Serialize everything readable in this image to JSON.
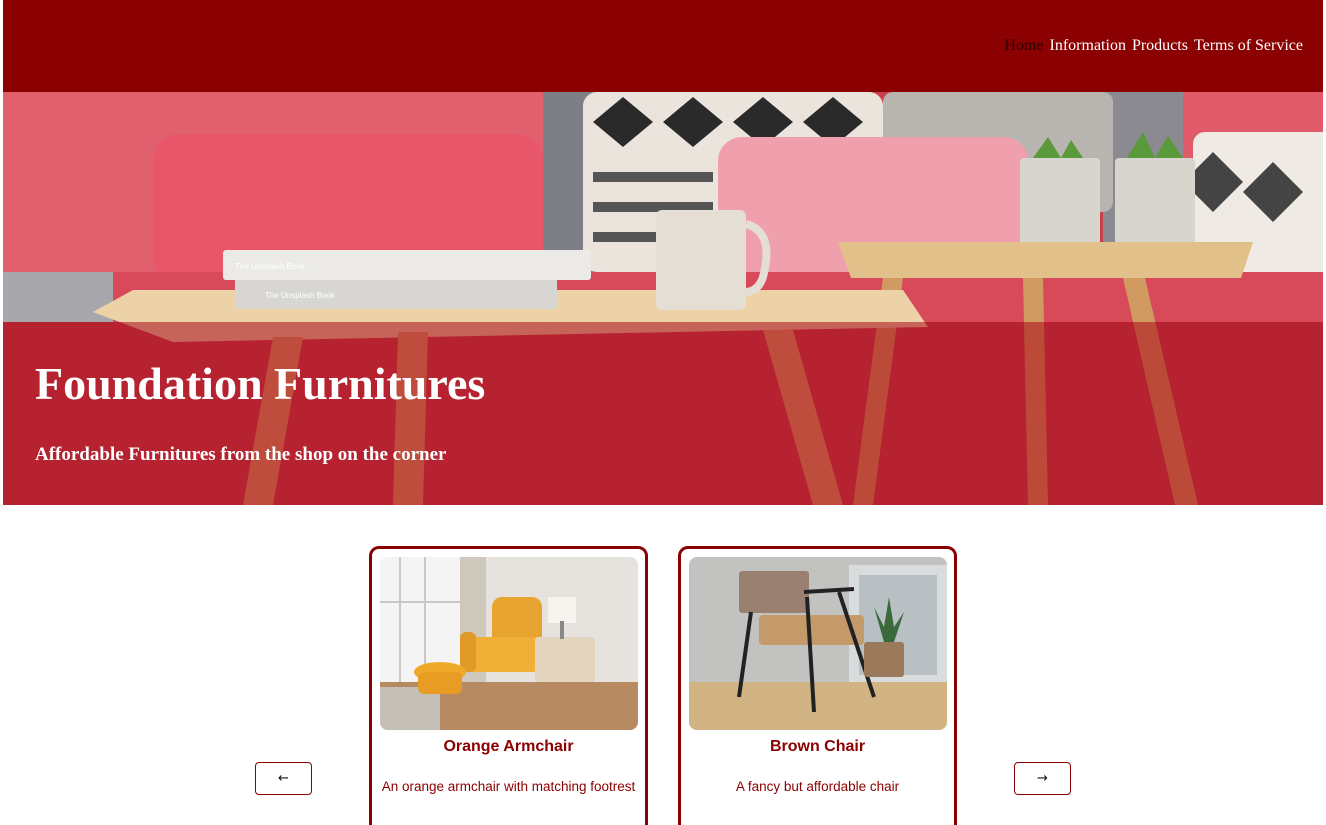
{
  "nav": {
    "items": [
      {
        "label": "Home",
        "active": true
      },
      {
        "label": "Information",
        "active": false
      },
      {
        "label": "Products",
        "active": false
      },
      {
        "label": "Terms of Service",
        "active": false
      }
    ]
  },
  "hero": {
    "title": "Foundation Furnitures",
    "subtitle": "Affordable Furnitures from the shop on the corner",
    "book_text": "The Unsplash Book"
  },
  "carousel": {
    "prev_icon": "arrow-left-icon",
    "next_icon": "arrow-right-icon",
    "prev_glyph": "←",
    "next_glyph": "→",
    "products": [
      {
        "title": "Orange Armchair",
        "description": "An orange armchair with matching footrest"
      },
      {
        "title": "Brown Chair",
        "description": "A fancy but affordable chair"
      }
    ]
  },
  "colors": {
    "brand": "#8b0000",
    "white": "#ffffff"
  }
}
